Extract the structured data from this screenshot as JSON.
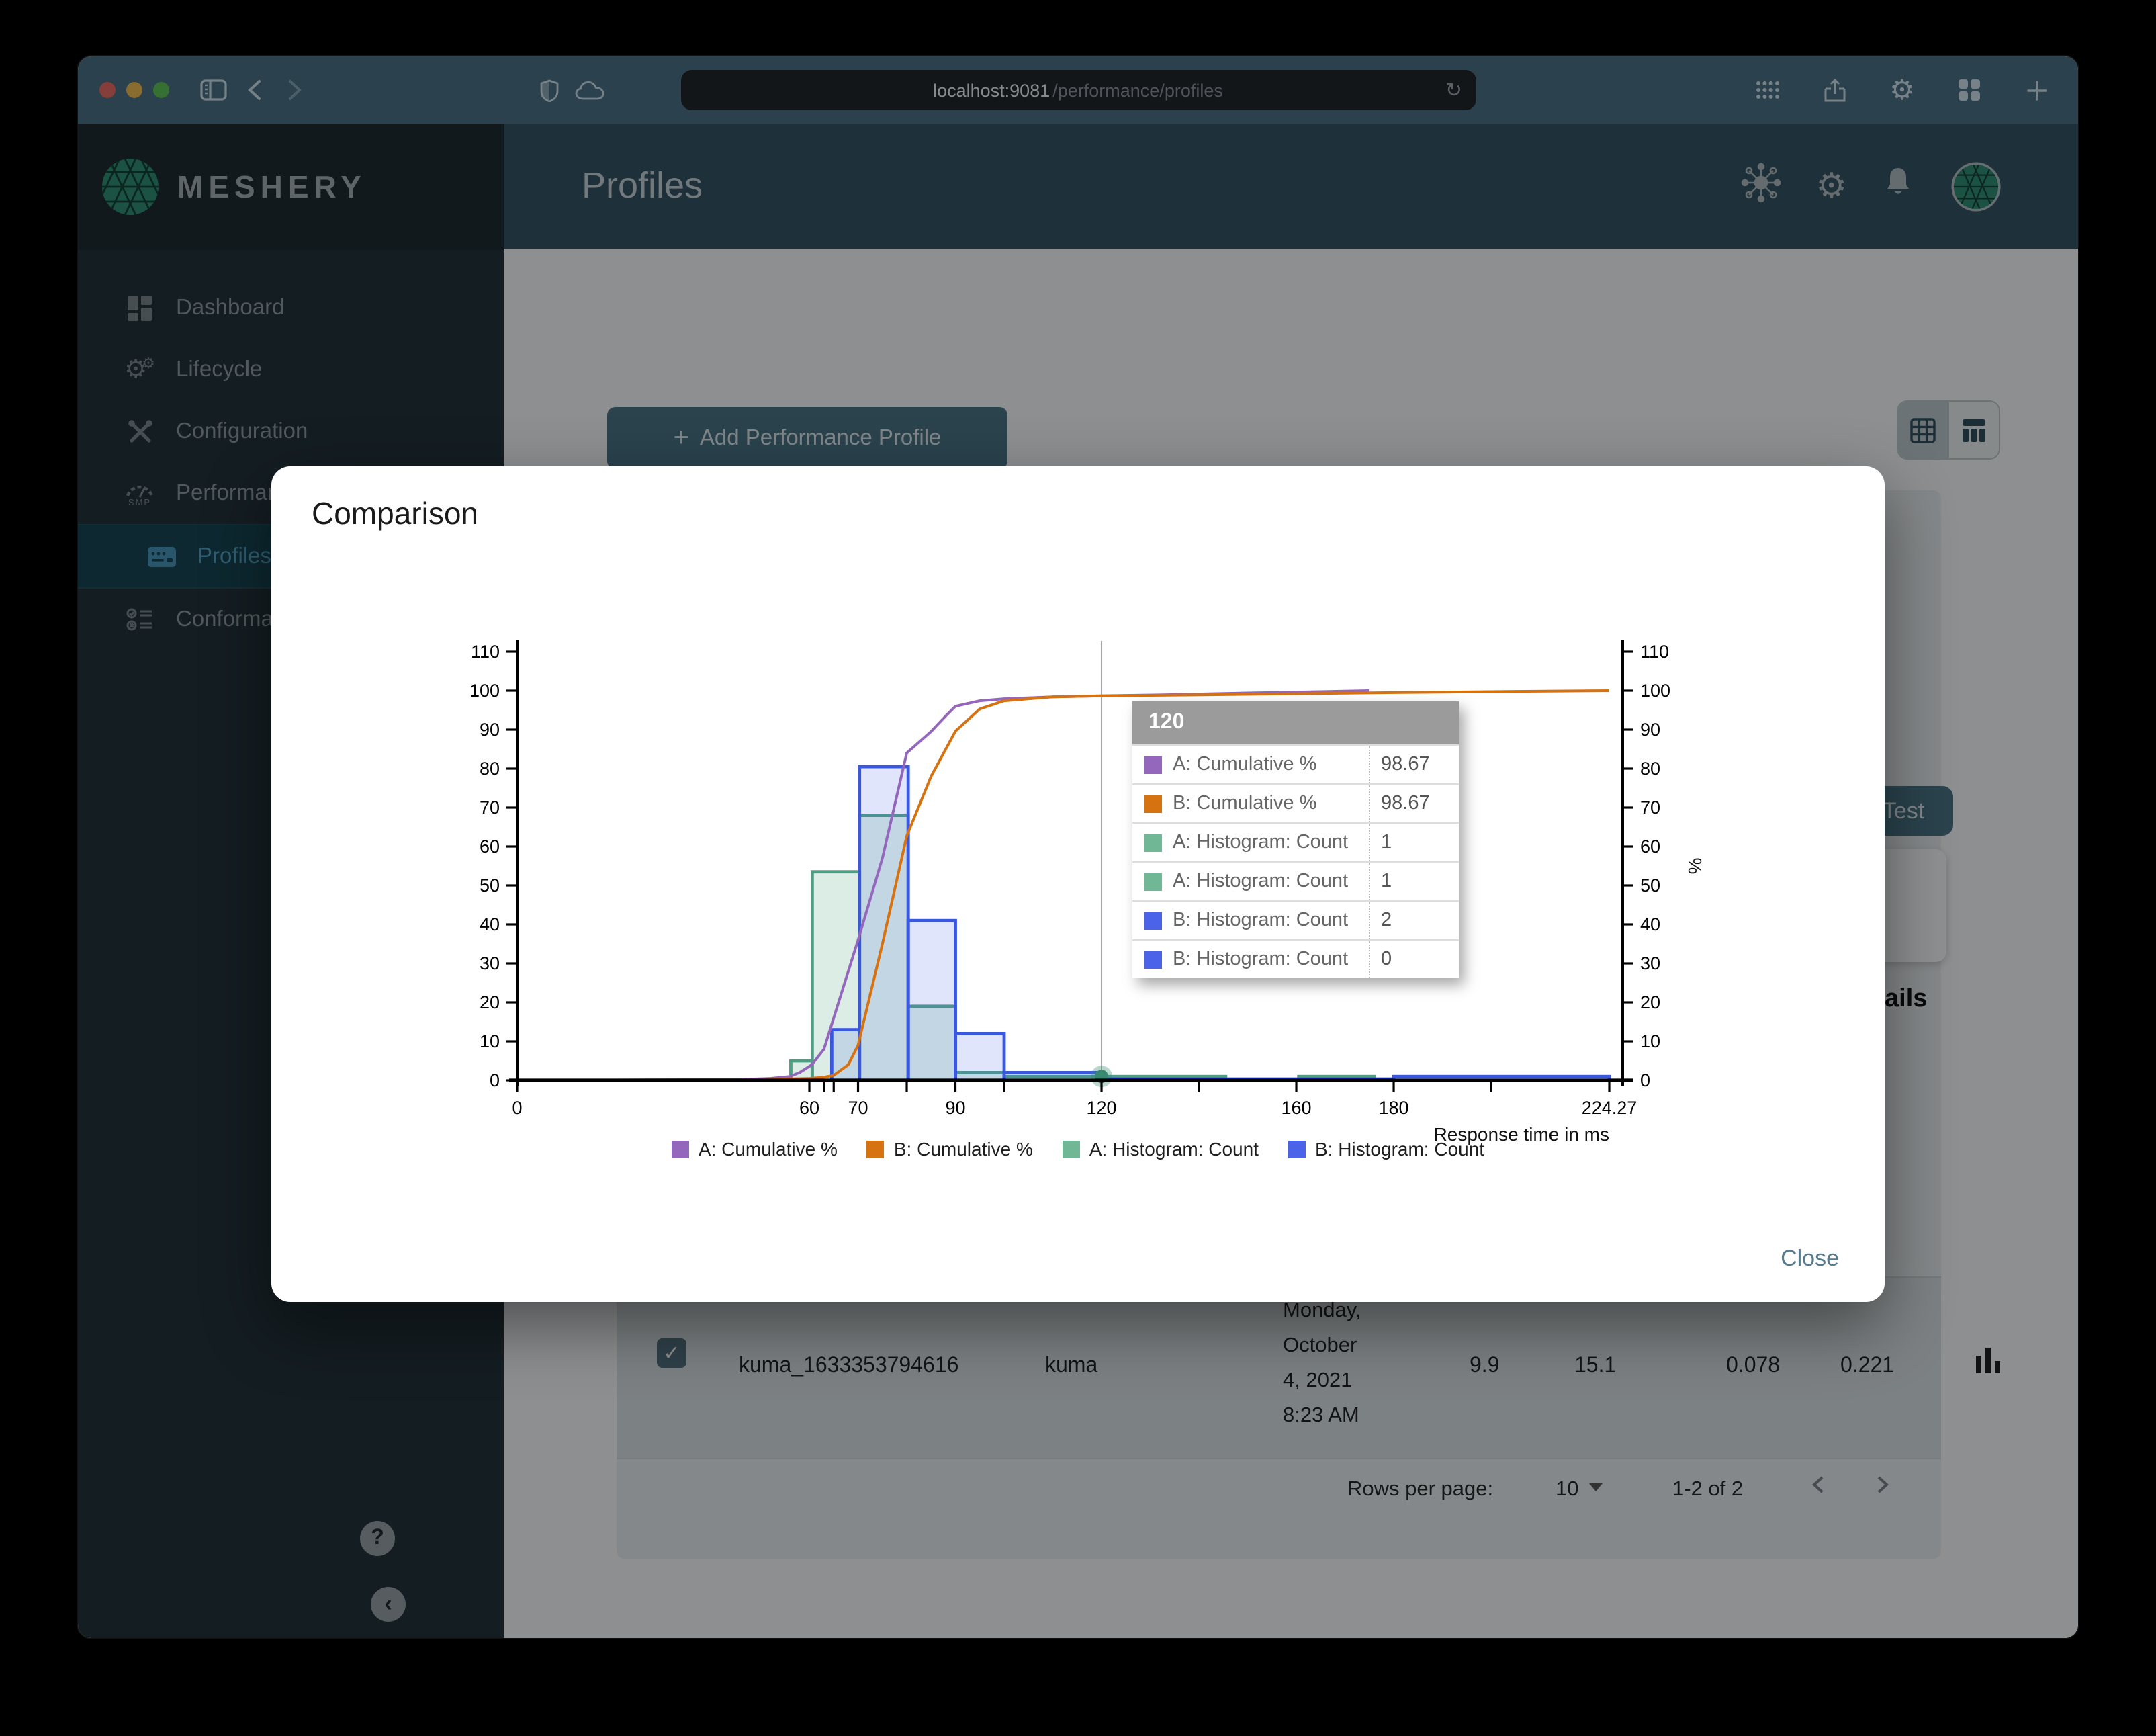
{
  "browser": {
    "url_host": "localhost:9081",
    "url_path": "/performance/profiles",
    "refresh_glyph": "↻"
  },
  "brand": {
    "name": "MESHERY"
  },
  "appbar": {
    "title": "Profiles"
  },
  "sidebar": {
    "items": [
      {
        "label": "Dashboard"
      },
      {
        "label": "Lifecycle"
      },
      {
        "label": "Configuration"
      },
      {
        "label": "Performance"
      },
      {
        "label": "Profiles",
        "selected": true
      },
      {
        "label": "Conformance"
      }
    ],
    "help_glyph": "?",
    "collapse_glyph": "‹"
  },
  "content": {
    "add_button_label": "Add Performance Profile",
    "add_button_plus": "+",
    "test_button_label": "Test",
    "back_arrow_glyph": "←",
    "details_fragment": "ails"
  },
  "table": {
    "row": {
      "check_glyph": "✓",
      "name": "kuma_1633353794616",
      "mesh": "kuma",
      "date_lines": [
        "Monday,",
        "October",
        "4, 2021",
        "8:23 AM"
      ],
      "qps": "9.9",
      "duration": "15.1",
      "p50": "0.078",
      "p99": "0.221"
    }
  },
  "pagination": {
    "rows_per_page_label": "Rows per page:",
    "rows_per_page_value": "10",
    "range": "1-2 of 2"
  },
  "modal": {
    "title": "Comparison",
    "close_label": "Close"
  },
  "chart_data": {
    "type": "histogram + cumulative line (comparison)",
    "xlabel": "Response time in ms",
    "x_axis": {
      "min": 0,
      "max": 224.27,
      "ticks": [
        {
          "v": 0,
          "l": "0"
        },
        {
          "v": 60,
          "l": "60"
        },
        {
          "v": 70,
          "l": "70"
        },
        {
          "v": 90,
          "l": "90"
        },
        {
          "v": 120,
          "l": "120"
        },
        {
          "v": 160,
          "l": "160"
        },
        {
          "v": 180,
          "l": "180"
        },
        {
          "v": 224.27,
          "l": "224.27"
        }
      ],
      "minor_ticks": [
        63,
        65,
        80,
        100,
        140,
        200
      ]
    },
    "y_axis": {
      "min": 0,
      "max": 110,
      "step": 10,
      "right_label": "%"
    },
    "series": [
      {
        "name": "A: Cumulative %",
        "type": "line",
        "color": "#9467BD",
        "points": [
          [
            0,
            0
          ],
          [
            45,
            0.2
          ],
          [
            52,
            0.5
          ],
          [
            56,
            1
          ],
          [
            58,
            2
          ],
          [
            60.5,
            4
          ],
          [
            63,
            8
          ],
          [
            66,
            20
          ],
          [
            70,
            36
          ],
          [
            75,
            57
          ],
          [
            80,
            84
          ],
          [
            85,
            89.5
          ],
          [
            88,
            93.5
          ],
          [
            90,
            96
          ],
          [
            95,
            97.4
          ],
          [
            100,
            97.9
          ],
          [
            110,
            98.4
          ],
          [
            120,
            98.67
          ],
          [
            132,
            98.9
          ],
          [
            150,
            99.4
          ],
          [
            163,
            99.7
          ],
          [
            175,
            100
          ]
        ]
      },
      {
        "name": "B: Cumulative %",
        "type": "line",
        "color": "#D6720F",
        "points": [
          [
            0,
            0
          ],
          [
            50,
            0.2
          ],
          [
            60,
            0.5
          ],
          [
            63,
            0.8
          ],
          [
            65,
            1.3
          ],
          [
            68,
            4
          ],
          [
            70,
            9
          ],
          [
            75,
            35
          ],
          [
            80,
            62.7
          ],
          [
            85,
            78
          ],
          [
            90,
            89.6
          ],
          [
            95,
            95.3
          ],
          [
            100,
            97.4
          ],
          [
            110,
            98.4
          ],
          [
            120,
            98.67
          ],
          [
            135,
            98.85
          ],
          [
            160,
            99.2
          ],
          [
            180,
            99.5
          ],
          [
            205,
            99.8
          ],
          [
            224.27,
            100
          ]
        ]
      },
      {
        "name": "A: Histogram: Count",
        "type": "histogram",
        "stroke": "#4E9D85",
        "fill": "rgba(112,183,149,0.25)",
        "bins": [
          [
            56.2,
            60.6,
            5
          ],
          [
            60.6,
            70.3,
            53.5
          ],
          [
            70.3,
            80.3,
            68
          ],
          [
            80.3,
            90,
            19
          ],
          [
            90,
            100,
            2
          ],
          [
            100,
            120,
            1
          ],
          [
            120,
            145.5,
            1
          ],
          [
            160.5,
            176,
            1
          ]
        ]
      },
      {
        "name": "B: Histogram: Count",
        "type": "histogram",
        "stroke": "#3A57DF",
        "fill": "rgba(74,99,232,0.17)",
        "bins": [
          [
            64.6,
            70.3,
            13
          ],
          [
            70.3,
            80.3,
            80.5
          ],
          [
            80.3,
            90,
            41
          ],
          [
            90,
            100,
            12
          ],
          [
            100,
            120,
            2
          ],
          [
            120,
            180,
            0
          ],
          [
            180,
            224.27,
            1
          ]
        ]
      }
    ],
    "legend": [
      {
        "label": "A: Cumulative %",
        "color": "#9467BD"
      },
      {
        "label": "B: Cumulative %",
        "color": "#D6720F"
      },
      {
        "label": "A: Histogram: Count",
        "color": "#70B795"
      },
      {
        "label": "B: Histogram: Count",
        "color": "#4A63E8"
      }
    ],
    "crosshair": {
      "x": 120
    },
    "marker": {
      "x": 120,
      "y": 1,
      "color": "#378a70"
    },
    "tooltip": {
      "header": "120",
      "rows": [
        {
          "swatch": "#9467BD",
          "label": "A: Cumulative %",
          "value": "98.67"
        },
        {
          "swatch": "#D6720F",
          "label": "B: Cumulative %",
          "value": "98.67"
        },
        {
          "swatch": "#70B795",
          "label": "A: Histogram: Count",
          "value": "1"
        },
        {
          "swatch": "#70B795",
          "label": "A: Histogram: Count",
          "value": "1"
        },
        {
          "swatch": "#4A63E8",
          "label": "B: Histogram: Count",
          "value": "2"
        },
        {
          "swatch": "#4A63E8",
          "label": "B: Histogram: Count",
          "value": "0"
        }
      ]
    }
  }
}
